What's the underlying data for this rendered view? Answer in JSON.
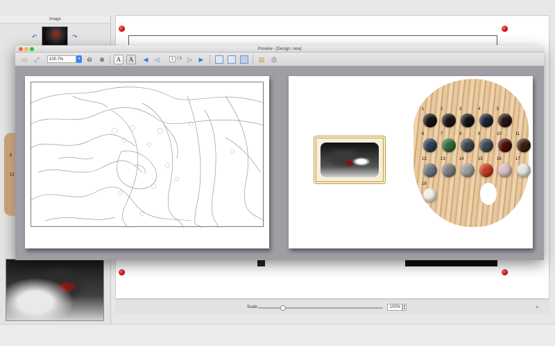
{
  "main_window": {
    "left_panel_title": "Image",
    "scale_label": "Scale",
    "scale_value": "100%",
    "scale_fraction": 0.2
  },
  "preview_window": {
    "title": "Preview - [Design: new]",
    "zoom_value": "100.7%",
    "page_current": "1",
    "page_total": "/ 3"
  },
  "left_side_numbers": [
    "6",
    "12"
  ],
  "palette": {
    "swatches": [
      {
        "num": "1",
        "color": "#151212"
      },
      {
        "num": "2",
        "color": "#181414"
      },
      {
        "num": "3",
        "color": "#121414"
      },
      {
        "num": "4",
        "color": "#1c2430"
      },
      {
        "num": "5",
        "color": "#2a1210"
      },
      {
        "num": "6",
        "color": "#2d3e55"
      },
      {
        "num": "7",
        "color": "#2e6a3c"
      },
      {
        "num": "8",
        "color": "#3d4448"
      },
      {
        "num": "9",
        "color": "#3b4650"
      },
      {
        "num": "10",
        "color": "#4a0d0a"
      },
      {
        "num": "11",
        "color": "#3b1e12"
      },
      {
        "num": "12",
        "color": "#6b7480"
      },
      {
        "num": "13",
        "color": "#7a7d80"
      },
      {
        "num": "14",
        "color": "#9c9a98"
      },
      {
        "num": "15",
        "color": "#c23a1c"
      },
      {
        "num": "16",
        "color": "#d8bcc0"
      },
      {
        "num": "17",
        "color": "#e4e4dd"
      },
      {
        "num": "18",
        "color": "#f3ece6"
      }
    ]
  }
}
